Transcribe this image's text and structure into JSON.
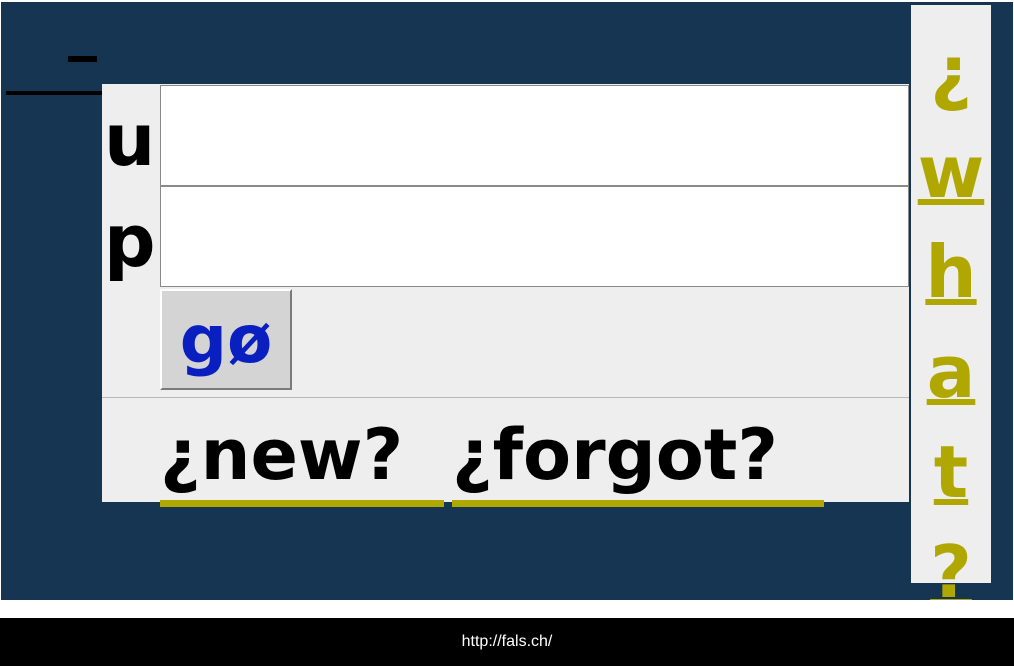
{
  "login": {
    "user_label": "u",
    "password_label": "p",
    "user_value": "",
    "password_value": "",
    "submit_label": "gø",
    "new_link": "¿new?",
    "forgot_link": "¿forgot?"
  },
  "sidebar": {
    "what_link_letters": [
      "¿",
      "w",
      "h",
      "a",
      "t",
      "?"
    ]
  },
  "footer": {
    "url": "http://fals.ch/"
  },
  "colors": {
    "panel_bg": "#153553",
    "form_bg": "#eeeeee",
    "link_accent": "#b0a800",
    "button_text": "#0a1fc0"
  }
}
